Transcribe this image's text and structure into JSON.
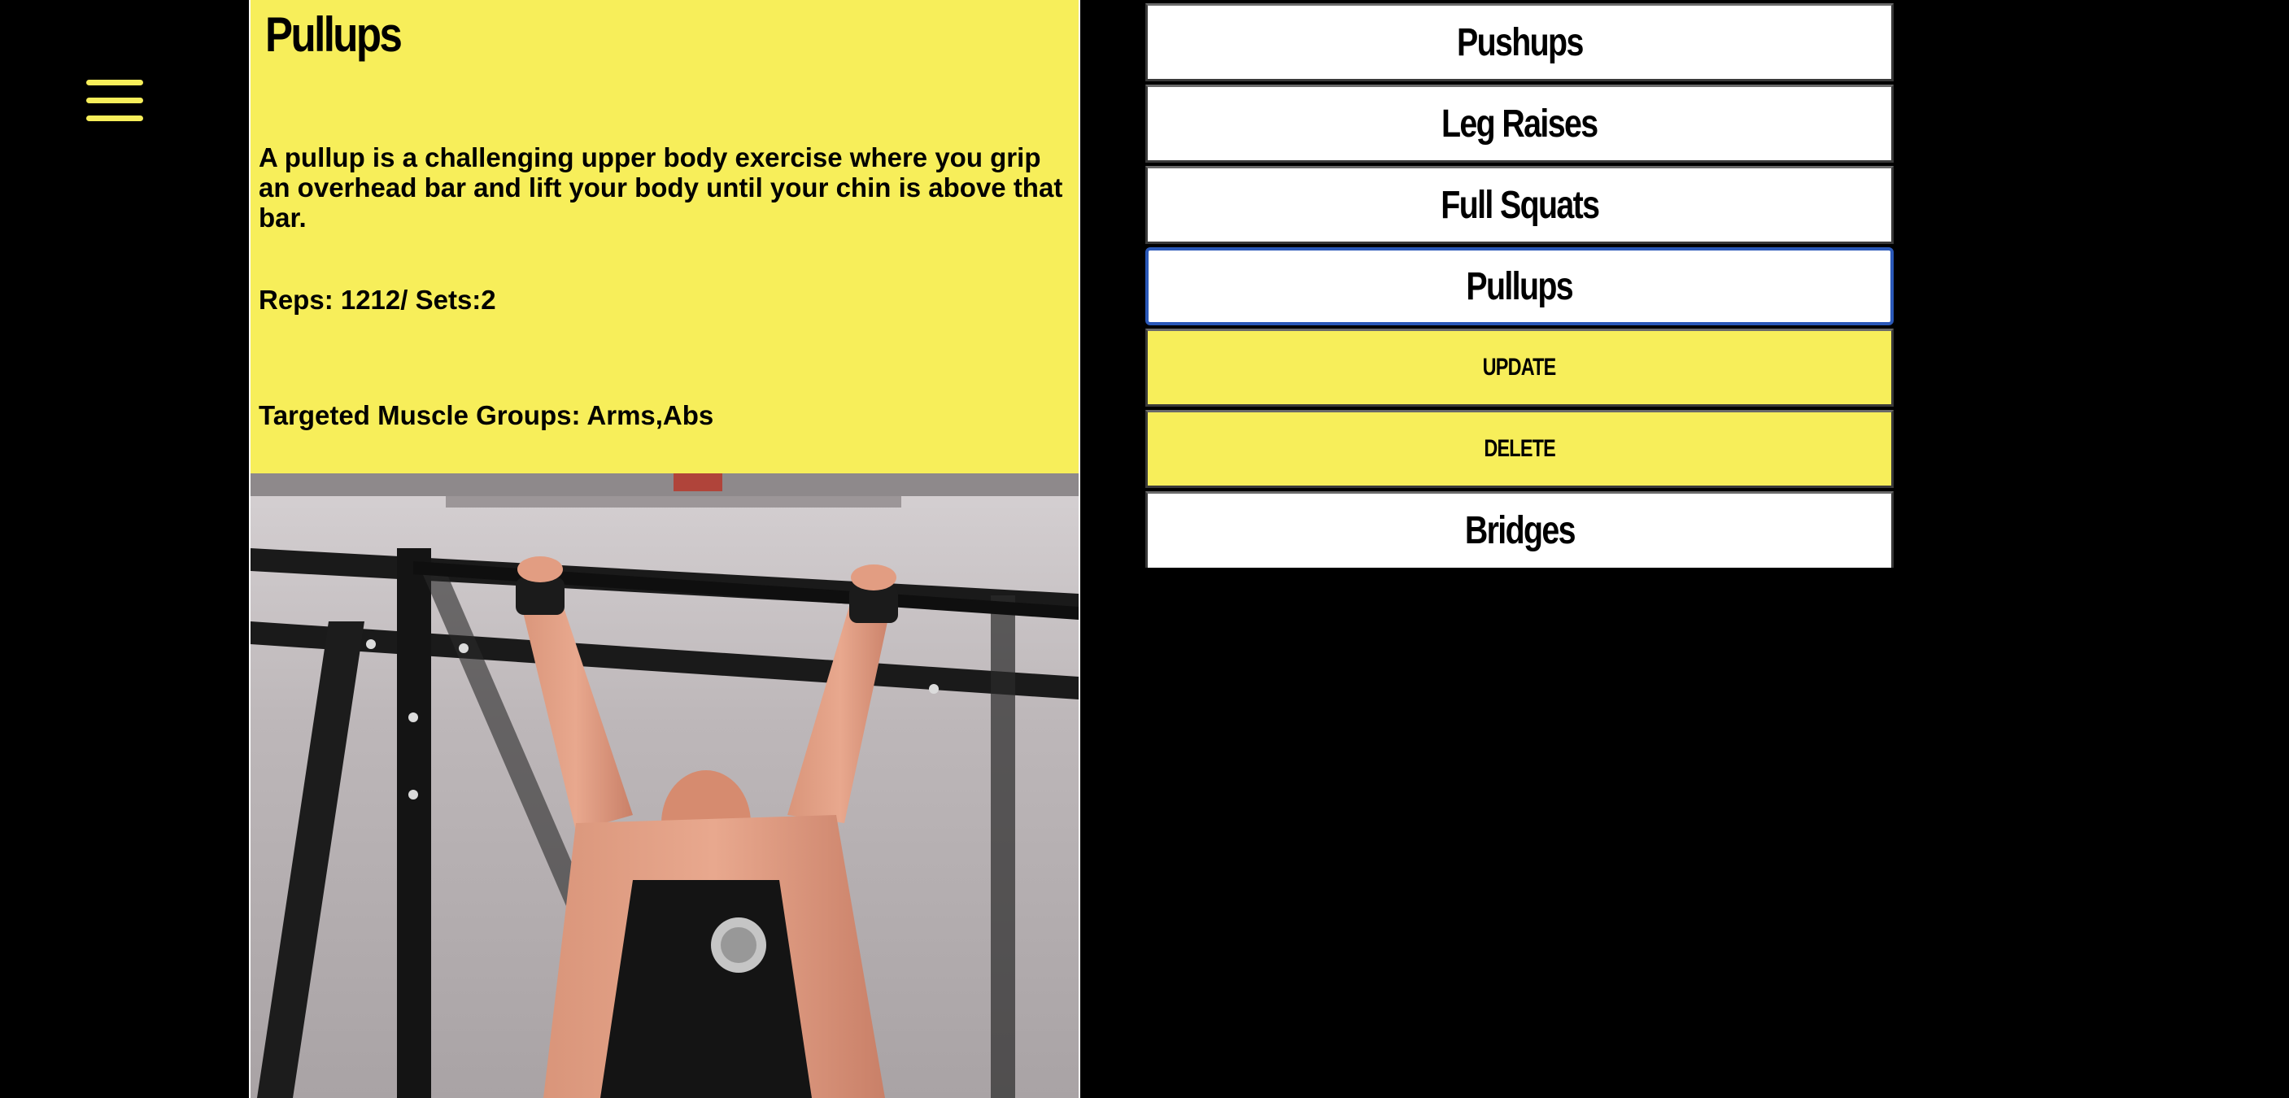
{
  "nav": {
    "menu_icon": "hamburger-menu-icon"
  },
  "detail": {
    "title": "Pullups",
    "description": "A pullup is a challenging upper body exercise where you grip an overhead bar and lift your body until your chin is above that bar.",
    "reps_sets": "Reps: 1212/ Sets:2",
    "muscle_groups": "Targeted Muscle Groups: Arms,Abs",
    "photo_subject": "man-doing-pullup-photo"
  },
  "exercise_list": {
    "items": [
      {
        "label": "Pushups"
      },
      {
        "label": "Leg Raises"
      },
      {
        "label": "Full Squats"
      },
      {
        "label": "Pullups"
      }
    ],
    "update_label": "UPDATE",
    "delete_label": "DELETE",
    "after_actions": [
      {
        "label": "Bridges"
      }
    ]
  },
  "colors": {
    "background": "#000000",
    "accent_yellow": "#f7ee5a",
    "list_item_bg": "#ffffff",
    "selected_border": "#2a58b8"
  }
}
